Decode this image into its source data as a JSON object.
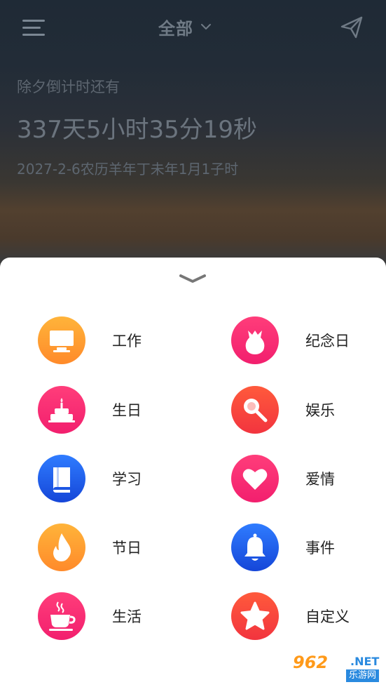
{
  "header": {
    "title": "全部",
    "menu_icon": "hamburger-menu-icon",
    "send_icon": "paper-plane-icon"
  },
  "countdown": {
    "label": "除夕倒计时还有",
    "time": "337天5小时35分19秒",
    "date": "2027-2-6农历羊年丁未年1月1子时"
  },
  "sheet": {
    "collapse_icon": "chevron-down-icon",
    "categories": [
      {
        "label": "工作",
        "icon": "monitor-icon",
        "color": "#ff9a2e"
      },
      {
        "label": "纪念日",
        "icon": "gift-bag-icon",
        "color": "#f52a70"
      },
      {
        "label": "生日",
        "icon": "birthday-cake-icon",
        "color": "#f52a70"
      },
      {
        "label": "娱乐",
        "icon": "microphone-icon",
        "color": "#f5413d"
      },
      {
        "label": "学习",
        "icon": "book-icon",
        "color": "#1f5fe8"
      },
      {
        "label": "爱情",
        "icon": "heart-icon",
        "color": "#f52a70"
      },
      {
        "label": "节日",
        "icon": "flame-icon",
        "color": "#ff9a2e"
      },
      {
        "label": "事件",
        "icon": "bell-icon",
        "color": "#1f5fe8"
      },
      {
        "label": "生活",
        "icon": "coffee-cup-icon",
        "color": "#f52a70"
      },
      {
        "label": "自定义",
        "icon": "star-icon",
        "color": "#f5413d"
      }
    ]
  },
  "watermark": {
    "main": "962",
    "net": ".NET",
    "sub": "乐游网"
  }
}
